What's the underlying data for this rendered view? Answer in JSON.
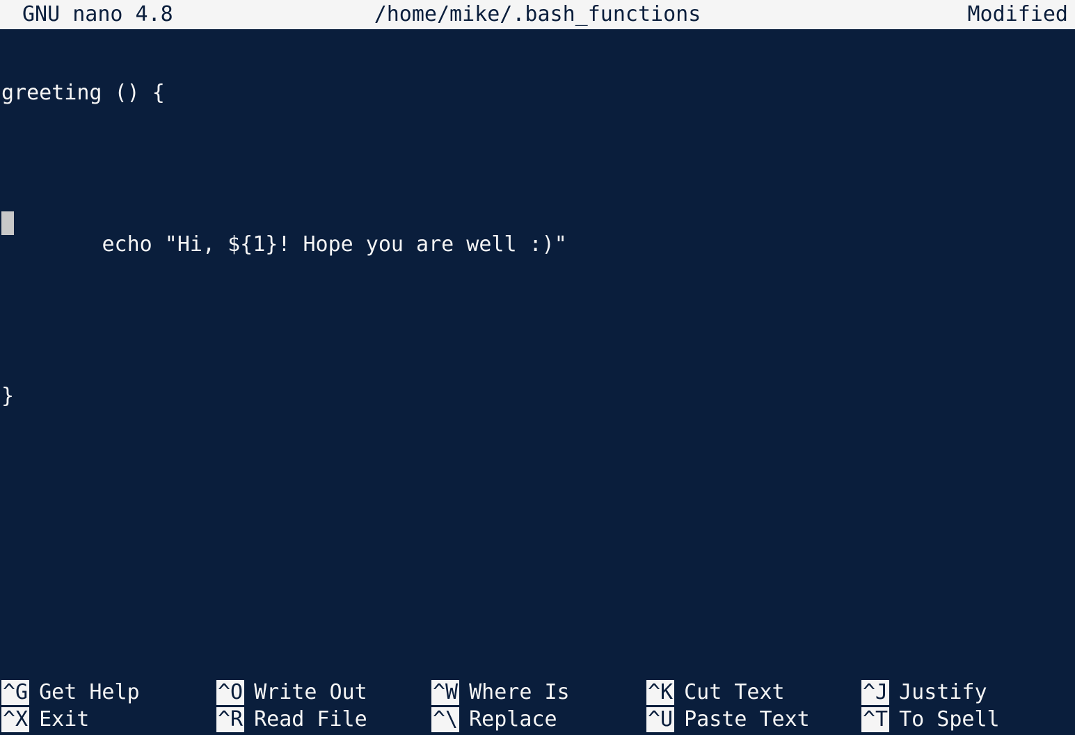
{
  "titlebar": {
    "app": "GNU nano 4.8",
    "file": "/home/mike/.bash_functions",
    "state": "Modified"
  },
  "editor": {
    "lines": [
      "greeting () {",
      "",
      "        echo \"Hi, ${1}! Hope you are well :)\"",
      "",
      "}",
      "",
      ""
    ]
  },
  "shortcuts": [
    {
      "key": "^G",
      "label": "Get Help"
    },
    {
      "key": "^O",
      "label": "Write Out"
    },
    {
      "key": "^W",
      "label": "Where Is"
    },
    {
      "key": "^K",
      "label": "Cut Text"
    },
    {
      "key": "^J",
      "label": "Justify"
    },
    {
      "key": "^X",
      "label": "Exit"
    },
    {
      "key": "^R",
      "label": "Read File"
    },
    {
      "key": "^\\",
      "label": "Replace"
    },
    {
      "key": "^U",
      "label": "Paste Text"
    },
    {
      "key": "^T",
      "label": "To Spell"
    }
  ]
}
